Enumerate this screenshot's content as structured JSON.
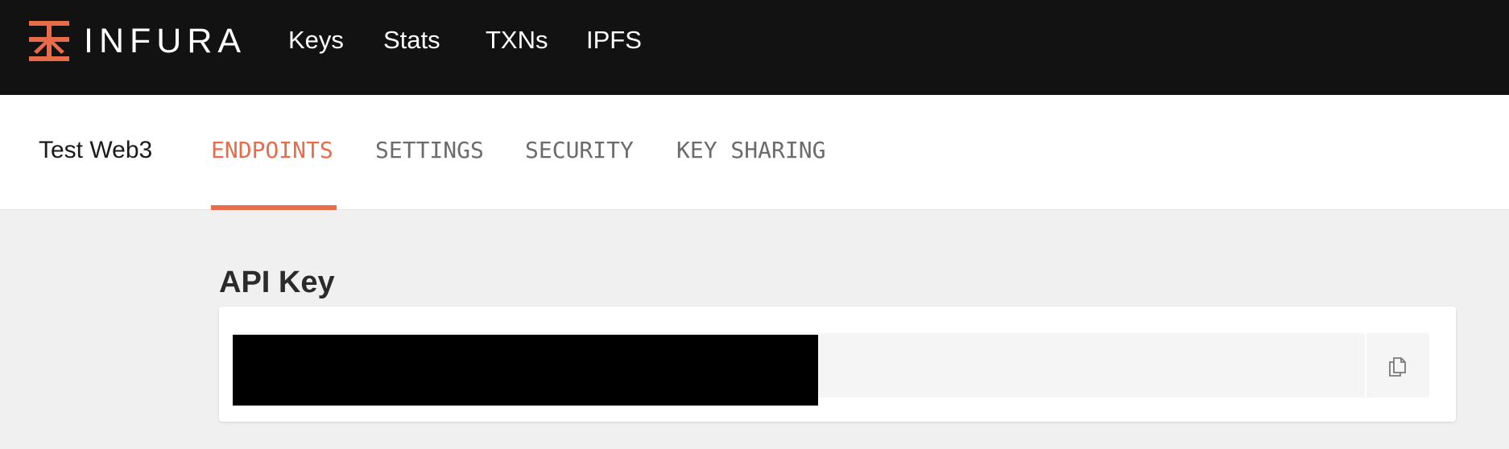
{
  "header": {
    "brand": "INFURA",
    "logo_icon": "infura-logo-icon",
    "accent_color": "#e96c4a",
    "nav": [
      {
        "label": "Keys"
      },
      {
        "label": "Stats"
      },
      {
        "label": "TXNs"
      },
      {
        "label": "IPFS"
      }
    ]
  },
  "project": {
    "name": "Test Web3",
    "active_tab": "ENDPOINTS",
    "tabs": [
      {
        "label": "ENDPOINTS"
      },
      {
        "label": "SETTINGS"
      },
      {
        "label": "SECURITY"
      },
      {
        "label": "KEY SHARING"
      }
    ]
  },
  "api_key": {
    "title": "API Key",
    "value_redacted": true,
    "copy_icon": "copy-icon"
  }
}
